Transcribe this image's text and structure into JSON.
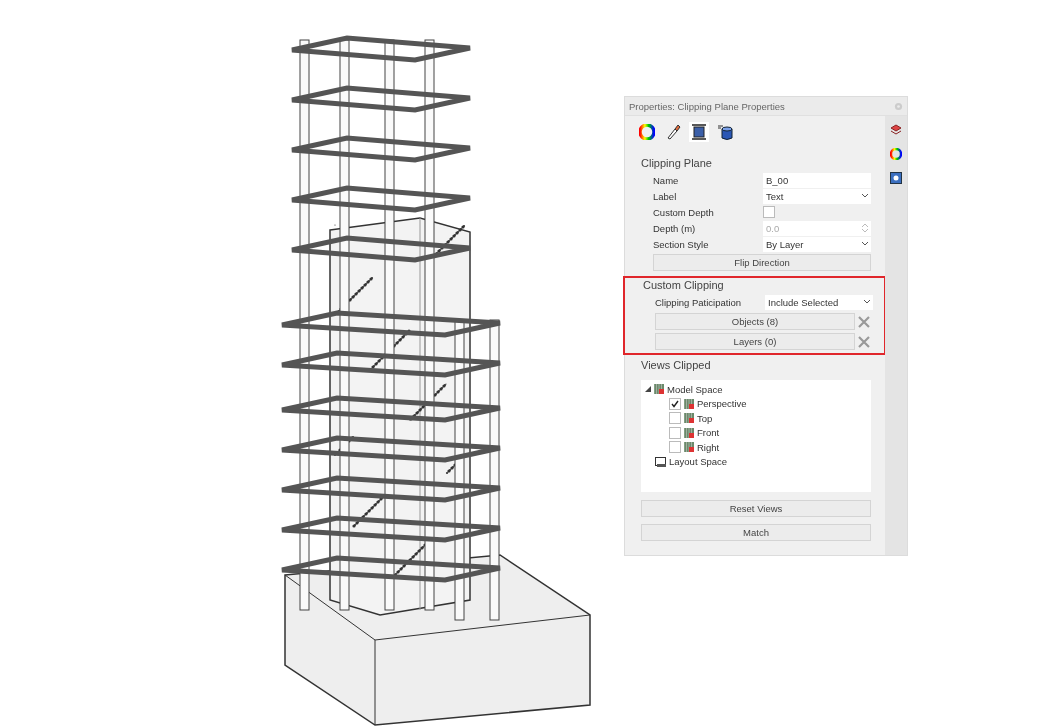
{
  "panel": {
    "title": "Properties: Clipping Plane Properties"
  },
  "clipping_plane": {
    "heading": "Clipping Plane",
    "fields": [
      {
        "kind": "text",
        "label": "Name",
        "value": "B_00"
      },
      {
        "kind": "dropdown",
        "label": "Label",
        "value": "Text"
      },
      {
        "kind": "checkbox",
        "label": "Custom Depth",
        "checked": false
      },
      {
        "kind": "spinner",
        "label": "Depth (m)",
        "value": "0.0",
        "disabled": true
      },
      {
        "kind": "dropdown",
        "label": "Section Style",
        "value": "By Layer"
      }
    ],
    "button": "Flip Direction"
  },
  "custom_clipping": {
    "heading": "Custom Clipping",
    "highlighted": true,
    "participation": {
      "label": "Clipping Paticipation",
      "value": "Include Selected"
    },
    "lists": [
      {
        "label": "Objects (8)"
      },
      {
        "label": "Layers (0)"
      }
    ]
  },
  "views_clipped": {
    "heading": "Views Clipped",
    "tree": [
      {
        "kind": "model",
        "label": "Model Space",
        "expanded": true,
        "children": [
          {
            "label": "Perspective",
            "checked": true
          },
          {
            "label": "Top",
            "checked": false
          },
          {
            "label": "Front",
            "checked": false
          },
          {
            "label": "Right",
            "checked": false
          }
        ]
      },
      {
        "kind": "layout",
        "label": "Layout Space"
      }
    ]
  },
  "buttons": [
    "Reset Views",
    "Match"
  ]
}
